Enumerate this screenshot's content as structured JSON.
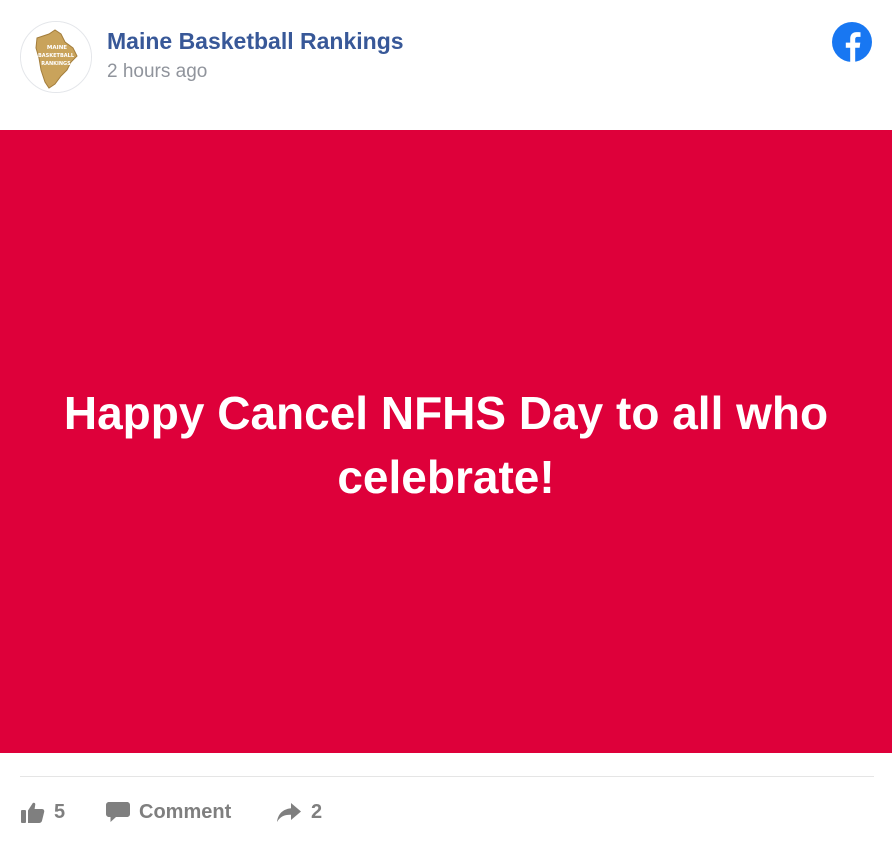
{
  "header": {
    "page_name": "Maine Basketball Rankings",
    "timestamp": "2 hours ago",
    "avatar_icon": "maine-basketball-rankings-logo",
    "avatar_logo_text": [
      "MAINE",
      "BASKETBALL",
      "RANKINGS"
    ],
    "platform_icon": "facebook-icon"
  },
  "post": {
    "image_text": "Happy Cancel NFHS Day to all who celebrate!",
    "background_color": "#de003a"
  },
  "footer": {
    "like_count": "5",
    "comment_label": "Comment",
    "share_count": "2",
    "like_icon": "thumbs-up-icon",
    "comment_icon": "comment-icon",
    "share_icon": "share-arrow-icon"
  },
  "colors": {
    "page_name": "#385898",
    "timestamp": "#90949c",
    "facebook_blue": "#1877f2",
    "action_text": "#7f7f7f"
  }
}
